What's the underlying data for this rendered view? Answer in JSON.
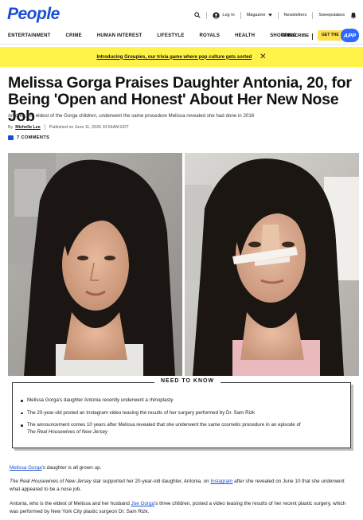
{
  "header": {
    "logo": "People",
    "login": "Log In",
    "magazine": "Magazine",
    "newsletters": "Newsletters",
    "sweepstakes": "Sweepstakes"
  },
  "nav": {
    "items": [
      "ENTERTAINMENT",
      "CRIME",
      "HUMAN INTEREST",
      "LIFESTYLE",
      "ROYALS",
      "HEALTH",
      "SHOPPING"
    ],
    "subscribe": "SUBSCRIBE",
    "get_the": "GET THE",
    "app": "APP"
  },
  "banner": {
    "text": "Introducing Groupies, our trivia game where pop culture gets sorted"
  },
  "article": {
    "headline": "Melissa Gorga Praises Daughter Antonia, 20, for Being 'Open and Honest' About Her New Nose Job",
    "dek": "Antonia, the eldest of the Gorga children, underwent the same procedure Melissa revealed she had done in 2016",
    "by": "By",
    "author": "Michelle Lee",
    "published": "Published on June 11, 2026 10:54AM EDT",
    "comments": "7 COMMENTS"
  },
  "need_to_know": {
    "title": "NEED TO KNOW",
    "items": [
      "Melissa Gorga's daughter Antonia recently underwent a rhinoplasty",
      "The 20-year-old posted an Instagram video teasing the results of her surgery performed by Dr. Sam Rizk",
      "The announcement comes 10 years after Melissa revealed that she underwent the same cosmetic procedure in an episode of",
      "The Real Housewives of New Jersey"
    ]
  },
  "body": {
    "p1_link": "Melissa Gorga",
    "p1_rest": "'s daughter is all grown up.",
    "p2_show": "The Real Housewives of New Jersey",
    "p2_mid": " star supported her 20-year-old daughter, Antonia, on ",
    "p2_link": "Instagram",
    "p2_rest": " after she revealed on June 10 that she underwent what appeared to be a nose job.",
    "p3_start": "Antonia, who is the eldest of Melissa and her husband ",
    "p3_link": "Joe Gorga",
    "p3_rest": "'s three children, posted a video teasing the results of her recent plastic surgery, which was performed by New York City plastic surgeon Dr. Sam Rizk."
  }
}
